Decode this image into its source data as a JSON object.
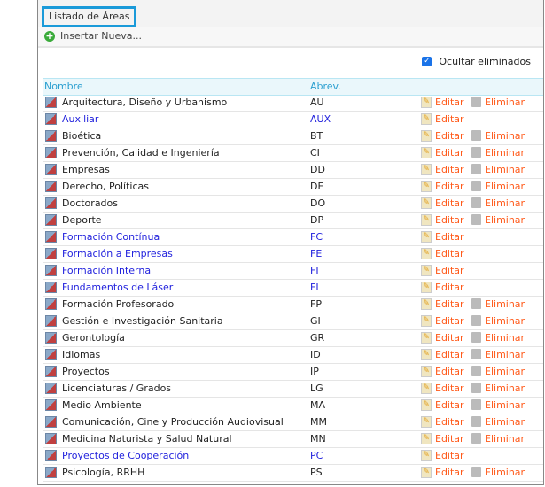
{
  "title": "Listado de Áreas",
  "toolbar": {
    "insert_label": "Insertar Nueva..."
  },
  "filter": {
    "hide_deleted_label": "Ocultar eliminados",
    "checked": true
  },
  "columns": {
    "name": "Nombre",
    "abbr": "Abrev."
  },
  "actions": {
    "edit": "Editar",
    "delete": "Eliminar"
  },
  "rows": [
    {
      "name": "Arquitectura, Diseño y Urbanismo",
      "abbr": "AU",
      "special": false
    },
    {
      "name": "Auxiliar",
      "abbr": "AUX",
      "special": true
    },
    {
      "name": "Bioética",
      "abbr": "BT",
      "special": false
    },
    {
      "name": "Prevención, Calidad e Ingeniería",
      "abbr": "CI",
      "special": false
    },
    {
      "name": "Empresas",
      "abbr": "DD",
      "special": false
    },
    {
      "name": "Derecho, Políticas",
      "abbr": "DE",
      "special": false
    },
    {
      "name": "Doctorados",
      "abbr": "DO",
      "special": false
    },
    {
      "name": "Deporte",
      "abbr": "DP",
      "special": false
    },
    {
      "name": "Formación Contínua",
      "abbr": "FC",
      "special": true
    },
    {
      "name": "Formación a Empresas",
      "abbr": "FE",
      "special": true
    },
    {
      "name": "Formación Interna",
      "abbr": "FI",
      "special": true
    },
    {
      "name": "Fundamentos de Láser",
      "abbr": "FL",
      "special": true
    },
    {
      "name": "Formación Profesorado",
      "abbr": "FP",
      "special": false
    },
    {
      "name": "Gestión e Investigación Sanitaria",
      "abbr": "GI",
      "special": false
    },
    {
      "name": "Gerontología",
      "abbr": "GR",
      "special": false
    },
    {
      "name": "Idiomas",
      "abbr": "ID",
      "special": false
    },
    {
      "name": "Proyectos",
      "abbr": "IP",
      "special": false
    },
    {
      "name": "Licenciaturas / Grados",
      "abbr": "LG",
      "special": false
    },
    {
      "name": "Medio Ambiente",
      "abbr": "MA",
      "special": false
    },
    {
      "name": "Comunicación, Cine y Producción Audiovisual",
      "abbr": "MM",
      "special": false
    },
    {
      "name": "Medicina Naturista y Salud Natural",
      "abbr": "MN",
      "special": false
    },
    {
      "name": "Proyectos de Cooperación",
      "abbr": "PC",
      "special": true
    },
    {
      "name": "Psicología, RRHH",
      "abbr": "PS",
      "special": false
    }
  ]
}
